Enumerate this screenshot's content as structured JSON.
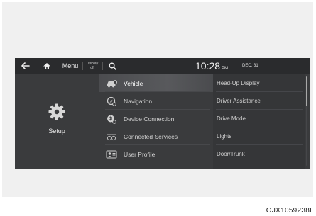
{
  "topbar": {
    "back_icon": "back-arrow-icon",
    "home_icon": "home-icon",
    "menu_label": "Menu",
    "display_off_line1": "Display",
    "display_off_line2": "off",
    "search_icon": "search-icon",
    "time": "10:28",
    "ampm": "PM",
    "date": "DEC. 31"
  },
  "setup": {
    "icon": "gear-icon",
    "label": "Setup"
  },
  "menu": {
    "items": [
      {
        "label": "Vehicle",
        "icon": "car-icon",
        "active": true
      },
      {
        "label": "Navigation",
        "icon": "navigation-icon",
        "active": false
      },
      {
        "label": "Device Connection",
        "icon": "device-connection-icon",
        "active": false
      },
      {
        "label": "Connected Services",
        "icon": "connected-services-icon",
        "active": false
      },
      {
        "label": "User Profile",
        "icon": "user-profile-icon",
        "active": false
      }
    ]
  },
  "submenu": {
    "items": [
      {
        "label": "Head-Up Display"
      },
      {
        "label": "Driver Assistance"
      },
      {
        "label": "Drive Mode"
      },
      {
        "label": "Lights"
      },
      {
        "label": "Door/Trunk"
      }
    ]
  },
  "caption": "OJX1059238L",
  "colors": {
    "screen_bg": "#3a3b3d",
    "topbar_bg": "#2a2b2d",
    "active_item_bg": "#58595c",
    "text": "#d2d2d2"
  }
}
